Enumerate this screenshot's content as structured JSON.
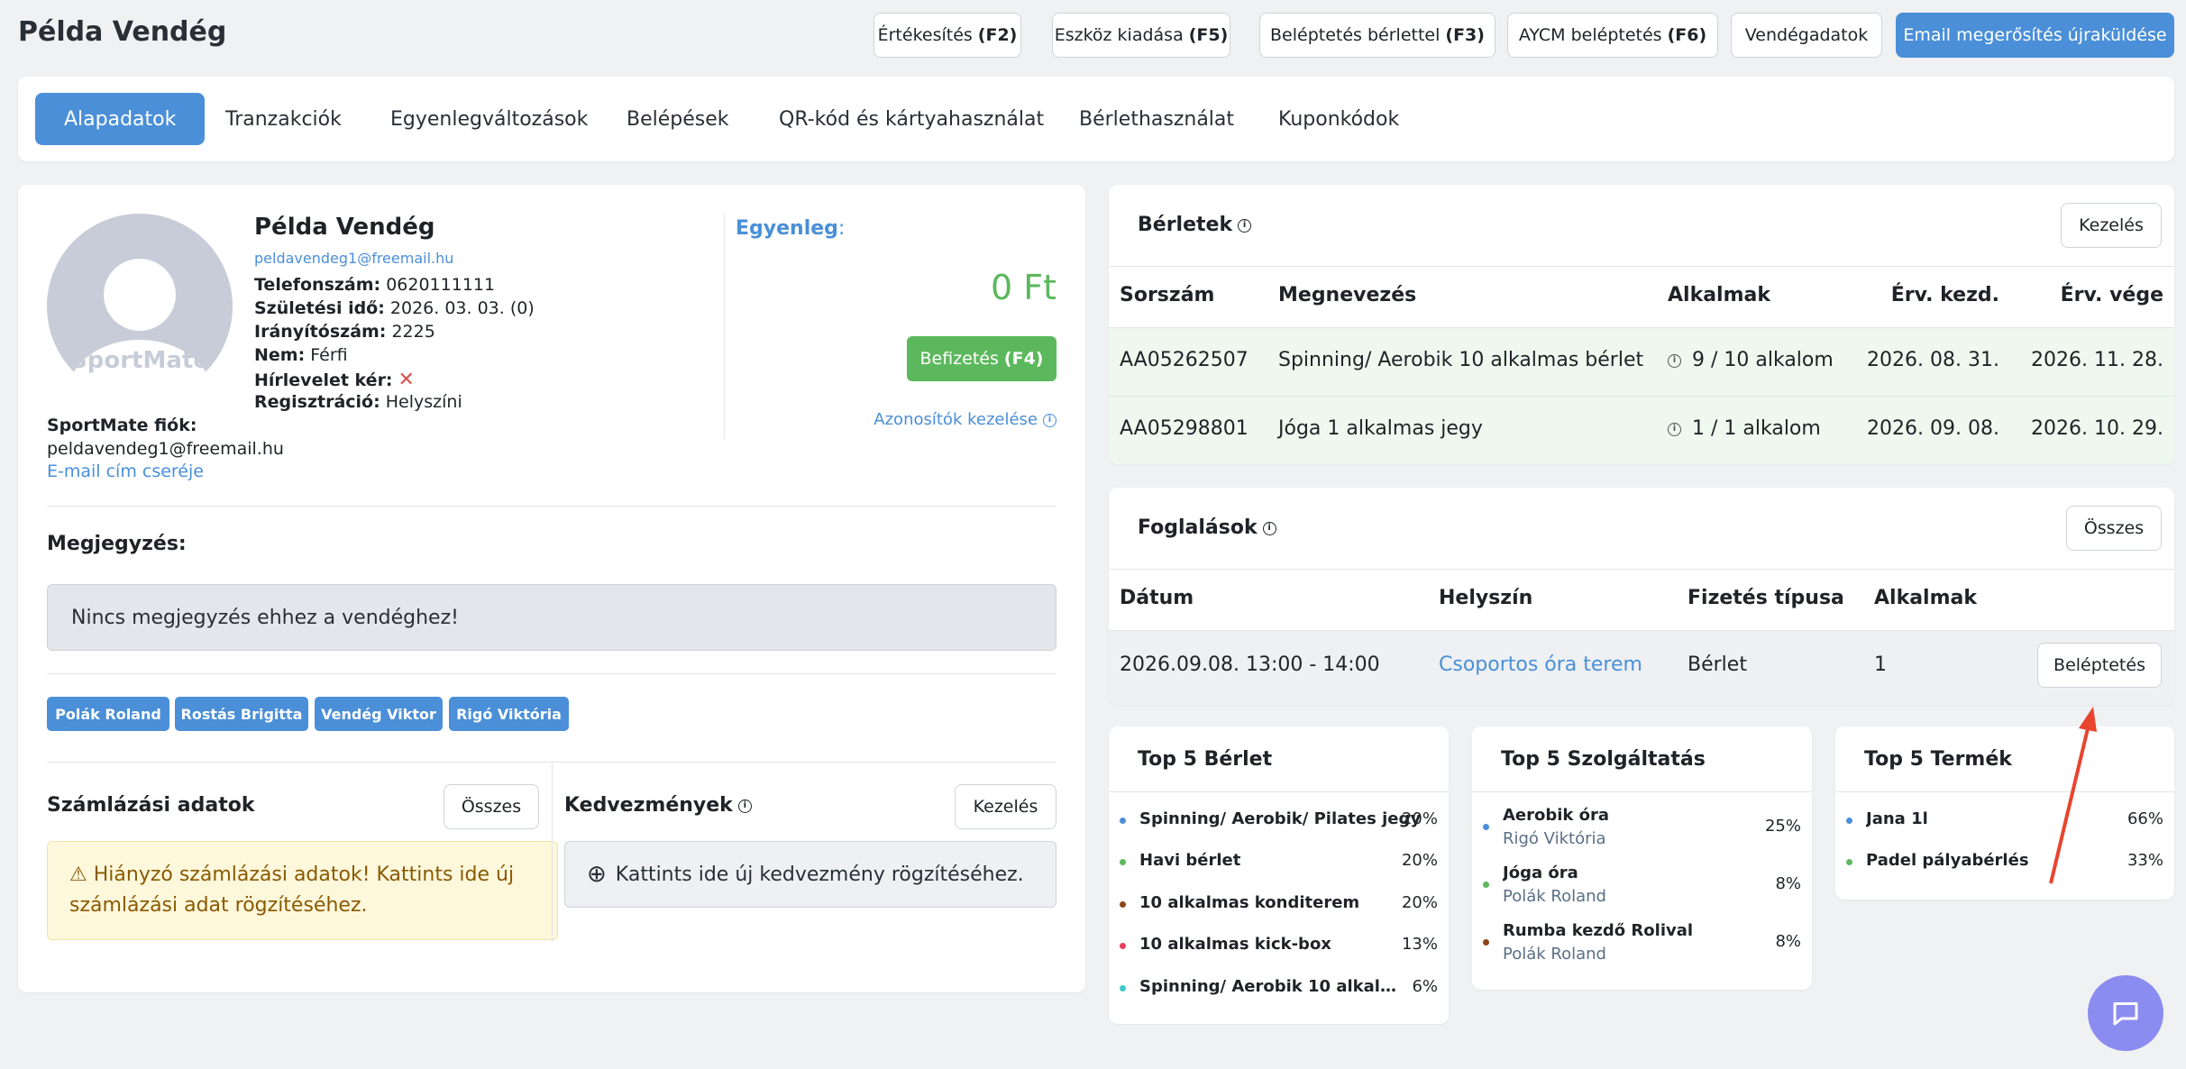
{
  "header": {
    "title": "Példa Vendég",
    "buttons": [
      {
        "label": "Értékesítés",
        "key": "(F2)"
      },
      {
        "label": "Eszköz kiadása",
        "key": "(F5)"
      },
      {
        "label": "Beléptetés bérlettel",
        "key": "(F3)"
      },
      {
        "label": "AYCM beléptetés",
        "key": "(F6)"
      },
      {
        "label": "Vendégadatok",
        "key": ""
      },
      {
        "label": "Email megerősítés újraküldése",
        "key": ""
      }
    ]
  },
  "tabs": [
    "Alapadatok",
    "Tranzakciók",
    "Egyenlegváltozások",
    "Belépések",
    "QR-kód és kártyahasználat",
    "Bérlethasználat",
    "Kuponkódok"
  ],
  "profile": {
    "name": "Példa Vendég",
    "email": "peldavendeg1@freemail.hu",
    "avatar_logo": "SportMate",
    "fields": [
      {
        "label": "Telefonszám:",
        "value": "0620111111"
      },
      {
        "label": "Születési idő:",
        "value": "2026. 03. 03. (0)"
      },
      {
        "label": "Irányítószám:",
        "value": "2225"
      },
      {
        "label": "Nem:",
        "value": "Férfi"
      },
      {
        "label": "Hírlevelet kér:",
        "value": ""
      },
      {
        "label": "Regisztráció:",
        "value": "Helyszíni"
      }
    ],
    "account_label": "SportMate fiók:",
    "account_email": "peldavendeg1@freemail.hu",
    "change_email_link": "E-mail cím cseréje"
  },
  "balance": {
    "label": "Egyenleg",
    "colon": ":",
    "value": "0 Ft",
    "pay_label": "Befizetés",
    "pay_key": "(F4)",
    "ids_link": "Azonosítók kezelése"
  },
  "note": {
    "label": "Megjegyzés:",
    "text": "Nincs megjegyzés ehhez a vendéghez!"
  },
  "tags": [
    "Polák Roland",
    "Rostás Brigitta",
    "Vendég Viktor",
    "Rigó Viktória"
  ],
  "billing": {
    "label": "Számlázási adatok",
    "button": "Összes",
    "warning": "Hiányzó számlázási adatok! Kattints ide új számlázási adat rögzítéséhez."
  },
  "discounts": {
    "label": "Kedvezmények",
    "button": "Kezelés",
    "add_text": "Kattints ide új kedvezmény rögzítéséhez."
  },
  "passes": {
    "title": "Bérletek",
    "button": "Kezelés",
    "columns": [
      "Sorszám",
      "Megnevezés",
      "Alkalmak",
      "Érv. kezd.",
      "Érv. vége"
    ],
    "rows": [
      {
        "id": "AA05262507",
        "name": "Spinning/ Aerobik 10 alkalmas bérlet",
        "uses": "9 / 10 alkalom",
        "start": "2026. 08. 31.",
        "end": "2026. 11. 28."
      },
      {
        "id": "AA05298801",
        "name": "Jóga 1 alkalmas jegy",
        "uses": "1 / 1 alkalom",
        "start": "2026. 09. 08.",
        "end": "2026. 10. 29."
      }
    ]
  },
  "bookings": {
    "title": "Foglalások",
    "button": "Összes",
    "columns": [
      "Dátum",
      "Helyszín",
      "Fizetés típusa",
      "Alkalmak"
    ],
    "rows": [
      {
        "date": "2026.09.08. 13:00 - 14:00",
        "place": "Csoportos óra terem",
        "payment": "Bérlet",
        "uses": "1",
        "action": "Beléptetés"
      }
    ]
  },
  "top_passes": {
    "title": "Top 5 Bérlet",
    "items": [
      {
        "name": "Spinning/ Aerobik/ Pilates jegy",
        "pct": "20%",
        "color": "#4a8fd8"
      },
      {
        "name": "Havi bérlet",
        "pct": "20%",
        "color": "#5cb85c"
      },
      {
        "name": "10 alkalmas konditerem",
        "pct": "20%",
        "color": "#8b4513"
      },
      {
        "name": "10 alkalmas kick-box",
        "pct": "13%",
        "color": "#e83e5c"
      },
      {
        "name": "Spinning/ Aerobik 10 alkalmas...",
        "pct": "6%",
        "color": "#3ec9c9"
      }
    ]
  },
  "top_services": {
    "title": "Top 5 Szolgáltatás",
    "items": [
      {
        "name": "Aerobik óra",
        "sub": "Rigó Viktória",
        "pct": "25%",
        "color": "#4a8fd8"
      },
      {
        "name": "Jóga óra",
        "sub": "Polák Roland",
        "pct": "8%",
        "color": "#5cb85c"
      },
      {
        "name": "Rumba kezdő Rolival",
        "sub": "Polák Roland",
        "pct": "8%",
        "color": "#8b4513"
      }
    ]
  },
  "top_products": {
    "title": "Top 5 Termék",
    "items": [
      {
        "name": "Jana 1l",
        "pct": "66%",
        "color": "#4a8fd8"
      },
      {
        "name": "Padel pályabérlés",
        "pct": "33%",
        "color": "#5cb85c"
      }
    ]
  },
  "colors": {
    "primary": "#4a8fd8",
    "success": "#5cb85c",
    "annotation_arrow": "#e8442e",
    "chat": "#8b8cf0"
  }
}
